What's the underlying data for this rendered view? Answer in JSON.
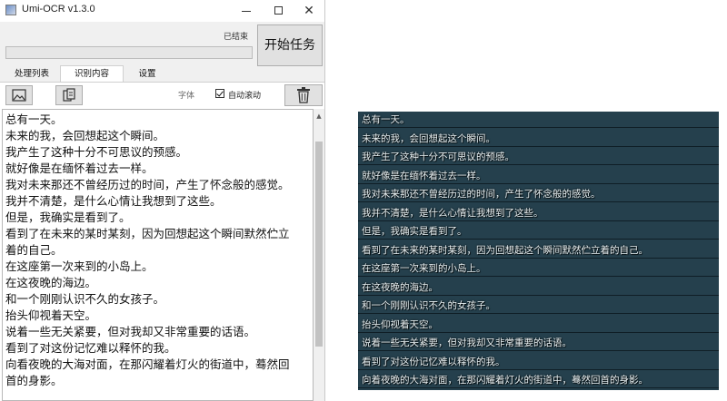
{
  "window": {
    "title": "Umi-OCR v1.3.0",
    "status": "已结束",
    "start_button": "开始任务",
    "progress_fraction": 0,
    "tabs": [
      "处理列表",
      "识别内容",
      "设置"
    ],
    "active_tab": "识别内容",
    "toolbar": {
      "image_icon": "image-icon",
      "copy_icon": "copy-icon",
      "delete_icon": "trash-icon",
      "font_link": "字体",
      "auto_scroll_label": "自动滚动",
      "auto_scroll_checked": true
    },
    "text_lines": [
      "总有一天。",
      "未来的我，会回想起这个瞬间。",
      "我产生了这种十分不可思议的预感。",
      "就好像是在缅怀着过去一样。",
      "我对未来那还不曾经历过的时间，产生了怀念般的感觉。",
      "我并不清楚，是什么心情让我想到了这些。",
      "但是，我确实是看到了。",
      "看到了在未来的某时某刻，因为回想起这个瞬间默然伫立",
      "着的自己。",
      "在这座第一次来到的小岛上。",
      "在这夜晚的海边。",
      "和一个刚刚认识不久的女孩子。",
      "抬头仰视着天空。",
      "说着一些无关紧要，但对我却又非常重要的话语。",
      "看到了对这份记忆难以释怀的我。",
      "向看夜晚的大海对面，在那闪耀着灯火的街道中，蓦然回",
      "首的身影。"
    ]
  },
  "subtitles": [
    "总有一天。",
    "未来的我，会回想起这个瞬间。",
    "我产生了这种十分不可思议的预感。",
    "就好像是在缅怀着过去一样。",
    "我对未来那还不曾经历过的时间，产生了怀念般的感觉。",
    "我并不清楚，是什么心情让我想到了这些。",
    "但是，我确实是看到了。",
    "看到了在未来的某时某刻，因为回想起这个瞬间默然伫立着的自己。",
    "在这座第一次来到的小岛上。",
    "在这夜晚的海边。",
    "和一个刚刚认识不久的女孩子。",
    "抬头仰视着天空。",
    "说着一些无关紧要，但对我却又非常重要的话语。",
    "看到了对这份记忆难以释怀的我。",
    "向着夜晚的大海对面，在那闪耀着灯火的街道中，蓦然回首的身影。"
  ]
}
